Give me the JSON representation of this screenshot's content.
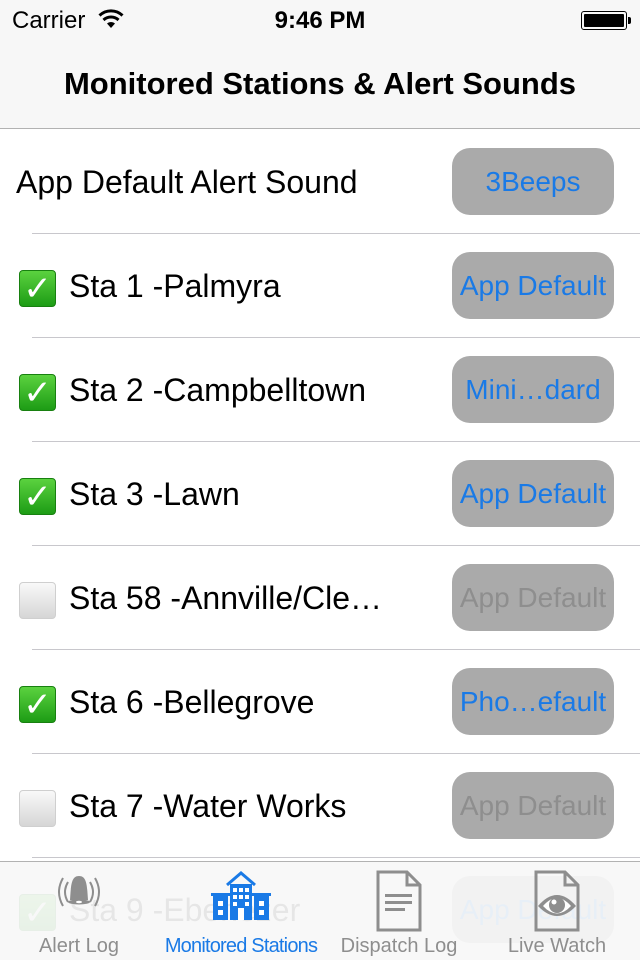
{
  "status_bar": {
    "carrier": "Carrier",
    "time": "9:46 PM",
    "battery_level": 1.0
  },
  "nav": {
    "title": "Monitored Stations & Alert Sounds"
  },
  "default_sound": {
    "label": "App Default Alert Sound",
    "value": "3Beeps"
  },
  "stations": [
    {
      "label": "Sta 1 -Palmyra",
      "checked": true,
      "sound": "App Default",
      "enabled": true
    },
    {
      "label": "Sta 2 -Campbelltown",
      "checked": true,
      "sound": "Mini…dard",
      "enabled": true
    },
    {
      "label": "Sta 3 -Lawn",
      "checked": true,
      "sound": "App Default",
      "enabled": true
    },
    {
      "label": "Sta 58 -Annville/Cle…",
      "checked": false,
      "sound": "App Default",
      "enabled": false
    },
    {
      "label": "Sta 6 -Bellegrove",
      "checked": true,
      "sound": "Pho…efault",
      "enabled": true
    },
    {
      "label": "Sta 7 -Water Works",
      "checked": false,
      "sound": "App Default",
      "enabled": false
    },
    {
      "label": "Sta 9 -Ebenezer",
      "checked": true,
      "sound": "App Default",
      "enabled": true
    }
  ],
  "tabs": [
    {
      "label": "Alert Log",
      "icon": "bell-icon",
      "active": false
    },
    {
      "label": "Monitored Stations",
      "icon": "building-icon",
      "active": true
    },
    {
      "label": "Dispatch Log",
      "icon": "document-icon",
      "active": false
    },
    {
      "label": "Live Watch",
      "icon": "eye-document-icon",
      "active": false
    }
  ],
  "colors": {
    "accent": "#1a7ae6",
    "inactive": "#8e8e8e",
    "button_bg": "#aaaaaa",
    "check_green": "#2aae20"
  }
}
